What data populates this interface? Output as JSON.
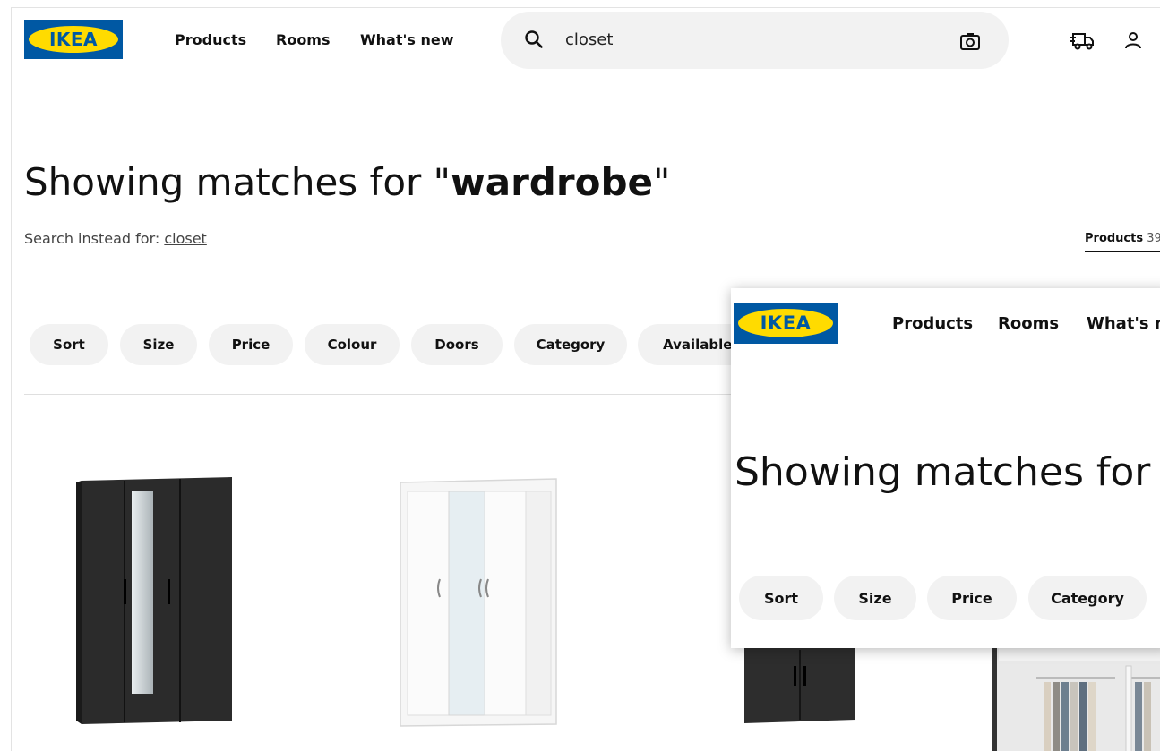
{
  "header": {
    "logo_text": "IKEA",
    "nav": [
      "Products",
      "Rooms",
      "What's new"
    ],
    "search": {
      "value": "closet",
      "icon": "search-icon",
      "camera_icon": "camera-icon"
    },
    "icons": [
      "delivery-truck-icon",
      "user-icon"
    ]
  },
  "results": {
    "headline_prefix": "Showing matches for \"",
    "headline_term": "wardrobe",
    "headline_suffix": "\"",
    "instead_label": "Search instead for: ",
    "instead_term": "closet",
    "tab_label": "Products",
    "tab_count": "39"
  },
  "filters": [
    "Sort",
    "Size",
    "Price",
    "Colour",
    "Doors",
    "Category",
    "Available o"
  ],
  "overlay": {
    "logo_text": "IKEA",
    "nav": [
      "Products",
      "Rooms",
      "What's ne"
    ],
    "headline": "Showing matches for \"",
    "filters": [
      "Sort",
      "Size",
      "Price",
      "Category"
    ]
  },
  "colors": {
    "brand_blue": "#0058a3",
    "brand_yellow": "#ffdb00",
    "pill_bg": "#f2f2f2"
  }
}
